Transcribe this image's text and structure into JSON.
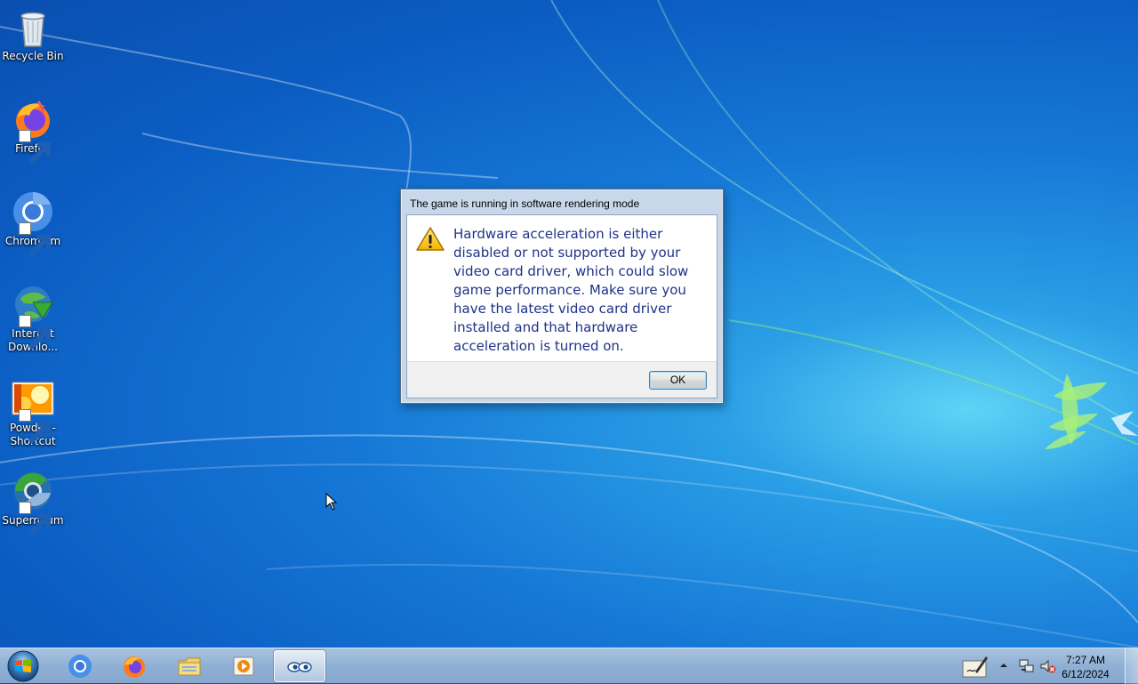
{
  "desktop": {
    "icons": [
      {
        "label": "Recycle Bin",
        "icon": "recycle-bin-icon"
      },
      {
        "label": "Firefox",
        "icon": "firefox-icon"
      },
      {
        "label": "Chromium",
        "icon": "chromium-icon"
      },
      {
        "label_line1": "Internet",
        "label_line2": "Downlo...",
        "icon": "internet-download-manager-icon"
      },
      {
        "label_line1": "Powder -",
        "label_line2": "Shortcut",
        "icon": "powder-icon"
      },
      {
        "label": "Supermium",
        "icon": "supermium-icon"
      }
    ]
  },
  "dialog": {
    "title": "The game is running in software rendering mode",
    "message": "Hardware acceleration is either disabled or not supported by your video card driver, which could slow game performance. Make sure you have the latest video card driver installed and that hardware acceleration is turned on.",
    "ok_label": "OK",
    "icon": "warning-icon"
  },
  "taskbar": {
    "start_icon": "windows-start-icon",
    "pinned": [
      "chromium-icon",
      "firefox-icon",
      "file-explorer-icon",
      "media-player-icon",
      "game-eyes-icon"
    ],
    "tray_icons": [
      "handwriting-icon",
      "show-hidden-icons-arrow",
      "network-icon",
      "volume-muted-icon"
    ],
    "clock_time": "7:27 AM",
    "clock_date": "6/12/2024"
  },
  "colors": {
    "message_text": "#1e3287",
    "desktop_blue": "#1678d6"
  }
}
